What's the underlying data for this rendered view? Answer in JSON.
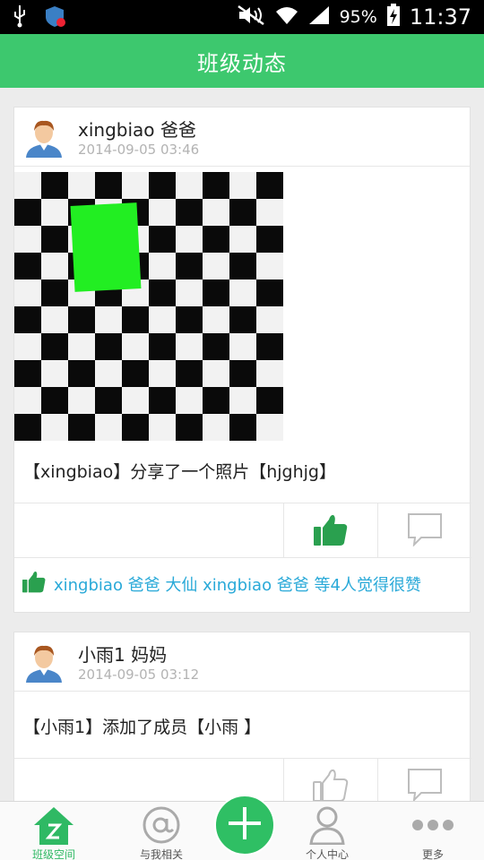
{
  "status_bar": {
    "battery": "95%",
    "time": "11:37"
  },
  "app_bar": {
    "title": "班级动态"
  },
  "posts": [
    {
      "author": "xingbiao 爸爸",
      "time": "2014-09-05 03:46",
      "text": "【xingbiao】分享了一个照片【hjghjg】",
      "liked": true,
      "likes_text": "xingbiao 爸爸  大仙  xingbiao 爸爸  等4人觉得很赞"
    },
    {
      "author": "小雨1 妈妈",
      "time": "2014-09-05 03:12",
      "text": "【小雨1】添加了成员【小雨 】",
      "liked": false
    }
  ],
  "bottom_nav": {
    "items": [
      {
        "label": "班级空间",
        "icon": "home-icon",
        "active": true
      },
      {
        "label": "与我相关",
        "icon": "at-icon",
        "active": false
      },
      {
        "label": "个人中心",
        "icon": "person-icon",
        "active": false
      },
      {
        "label": "更多",
        "icon": "more-icon",
        "active": false
      }
    ],
    "fab_icon": "plus-icon"
  },
  "colors": {
    "primary": "#3dc86e",
    "like_active": "#2aa04f",
    "link": "#29a9d8",
    "muted": "#b3b3b3"
  }
}
